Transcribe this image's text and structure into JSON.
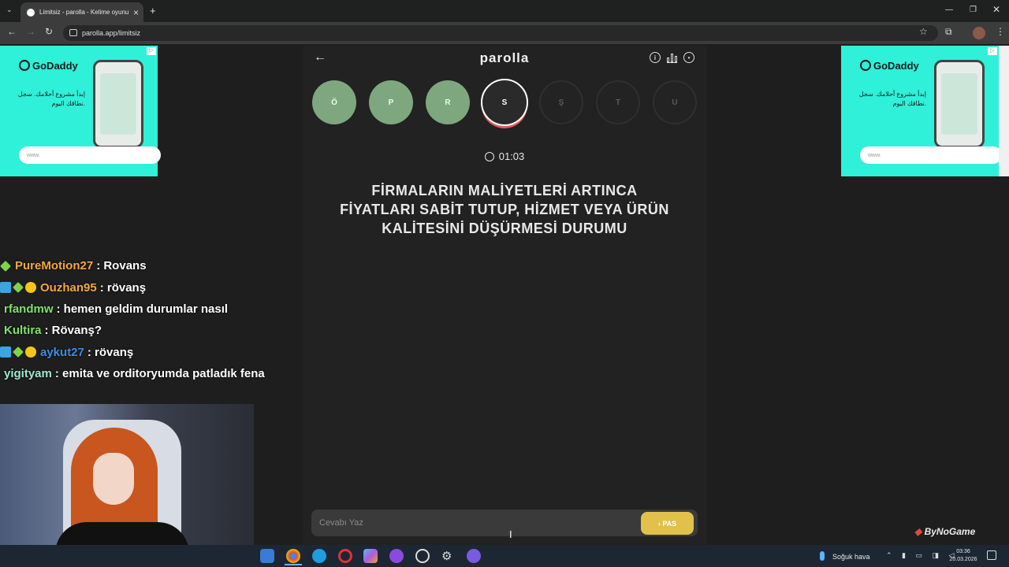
{
  "browser": {
    "tab_title": "Limitsiz - parolla - Kelime oyunu",
    "url": "parolla.app/limitsiz"
  },
  "ads": {
    "brand": "GoDaddy",
    "arabic_text": "إبدأ مشروع أحلامك. سجل نطاقك اليوم.",
    "www": "www."
  },
  "game": {
    "logo": "parolla",
    "letters": [
      {
        "letter": "Ö",
        "state": "done"
      },
      {
        "letter": "P",
        "state": "done"
      },
      {
        "letter": "R",
        "state": "done"
      },
      {
        "letter": "S",
        "state": "active"
      },
      {
        "letter": "Ş",
        "state": "pending"
      },
      {
        "letter": "T",
        "state": "pending"
      },
      {
        "letter": "U",
        "state": "pending"
      }
    ],
    "timer": "01:03",
    "question": "FİRMALARIN MALİYETLERİ ARTINCA FİYATLARI SABİT TUTUP, HİZMET VEYA ÜRÜN KALİTESİNİ DÜŞÜRMESİ DURUMU",
    "answer_placeholder": "Cevabı Yaz",
    "pass_label": "› PAS",
    "colors": {
      "done": "#7fa77f",
      "pass": "#e1c14a",
      "active_ring": "#e05a5a"
    }
  },
  "chat": [
    {
      "user": "PureMotion27",
      "color": "#f4a93a",
      "badges": [
        "green"
      ],
      "message": ": Rovans"
    },
    {
      "user": "Ouzhan95",
      "color": "#f4a93a",
      "badges": [
        "blue",
        "green",
        "yellow"
      ],
      "message": ": rövanş"
    },
    {
      "user": "rfandmw",
      "color": "#7fe36a",
      "badges": [],
      "message": ": hemen geldim durumlar nasıl"
    },
    {
      "user": "Kultira",
      "color": "#7fe36a",
      "badges": [],
      "message": ": Rövanş?"
    },
    {
      "user": "aykut27",
      "color": "#3a8ee6",
      "badges": [
        "blue",
        "green",
        "yellow"
      ],
      "message": ": rövanş"
    },
    {
      "user": "yigityam",
      "color": "#9fe8d0",
      "badges": [],
      "message": ": emita ve orditoryumda patladık fena"
    }
  ],
  "overlay": {
    "watermark": "ByNoGame"
  },
  "taskbar": {
    "weather": "Soğuk hava",
    "time": "03:36",
    "date": "20.03.2026"
  }
}
